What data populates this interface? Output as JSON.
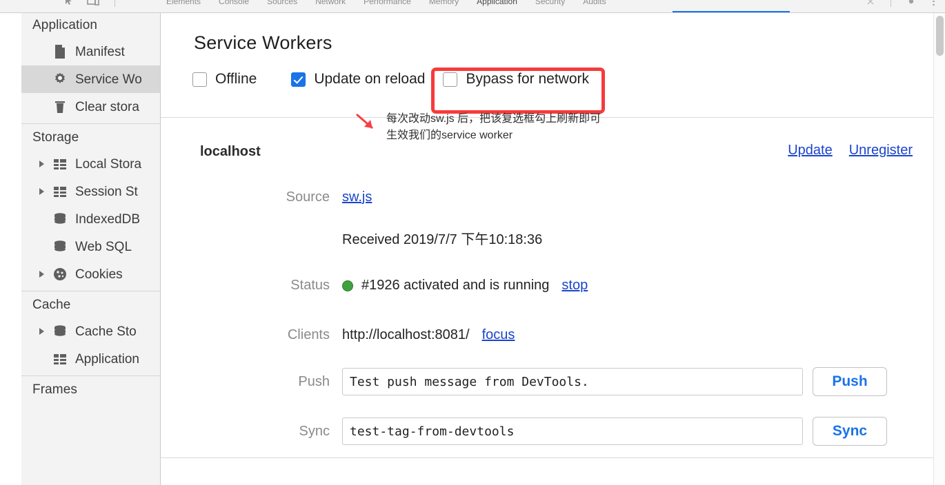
{
  "toolbar": {
    "left_icons": [
      "inspect-icon",
      "device-toolbar-icon"
    ],
    "tabs": [
      {
        "label": "Elements",
        "active": false
      },
      {
        "label": "Console",
        "active": false
      },
      {
        "label": "Sources",
        "active": false
      },
      {
        "label": "Network",
        "active": false
      },
      {
        "label": "Performance",
        "active": false
      },
      {
        "label": "Memory",
        "active": false
      },
      {
        "label": "Application",
        "active": true
      },
      {
        "label": "Security",
        "active": false
      },
      {
        "label": "Audits",
        "active": false
      }
    ],
    "right_icons": [
      "close-icon",
      "settings-icon",
      "more-icon"
    ],
    "accent_color": "#1a73e8"
  },
  "sidebar": {
    "sections": [
      {
        "title": "Application",
        "items": [
          {
            "label": "Manifest",
            "icon": "document-icon",
            "expandable": false,
            "selected": false
          },
          {
            "label": "Service Wo",
            "icon": "gear-icon",
            "expandable": false,
            "selected": true
          },
          {
            "label": "Clear stora",
            "icon": "trash-icon",
            "expandable": false,
            "selected": false
          }
        ]
      },
      {
        "title": "Storage",
        "items": [
          {
            "label": "Local Stora",
            "icon": "table-icon",
            "expandable": true,
            "selected": false
          },
          {
            "label": "Session St",
            "icon": "table-icon",
            "expandable": true,
            "selected": false
          },
          {
            "label": "IndexedDB",
            "icon": "database-icon",
            "expandable": false,
            "selected": false
          },
          {
            "label": "Web SQL",
            "icon": "database-icon",
            "expandable": false,
            "selected": false
          },
          {
            "label": "Cookies",
            "icon": "cookie-icon",
            "expandable": true,
            "selected": false
          }
        ]
      },
      {
        "title": "Cache",
        "items": [
          {
            "label": "Cache Sto",
            "icon": "database-icon",
            "expandable": true,
            "selected": false
          },
          {
            "label": "Application",
            "icon": "table-icon",
            "expandable": false,
            "selected": false
          }
        ]
      },
      {
        "title": "Frames",
        "items": []
      }
    ],
    "selected_bg": "#d8d8d8",
    "bg": "#f3f3f3"
  },
  "main": {
    "title": "Service Workers",
    "options": [
      {
        "label": "Offline",
        "checked": false
      },
      {
        "label": "Update on reload",
        "checked": true
      },
      {
        "label": "Bypass for network",
        "checked": false
      }
    ],
    "highlight_color": "#f73b3b",
    "annotation": {
      "color": "#f44046",
      "line1": "每次改动sw.js 后，把该复选框勾上刷新即可",
      "line2": "生效我们的service worker",
      "arrow": "diagonal-arrow-icon"
    },
    "registration": {
      "origin": "localhost",
      "actions": [
        {
          "label": "Update",
          "name": "update-link"
        },
        {
          "label": "Unregister",
          "name": "unregister-link"
        }
      ],
      "fields": {
        "source_label": "Source",
        "source_value": "sw.js",
        "received_text": "Received 2019/7/7 下午10:18:36",
        "status_label": "Status",
        "status_text": "#1926 activated and is running",
        "status_action": "stop",
        "status_color": "#3fa23f",
        "clients_label": "Clients",
        "clients_value": "http://localhost:8081/",
        "clients_action": "focus",
        "push_label": "Push",
        "push_value": "Test push message from DevTools.",
        "push_button": "Push",
        "sync_label": "Sync",
        "sync_value": "test-tag-from-devtools",
        "sync_button": "Sync"
      },
      "link_color": "#1a44cc"
    }
  }
}
